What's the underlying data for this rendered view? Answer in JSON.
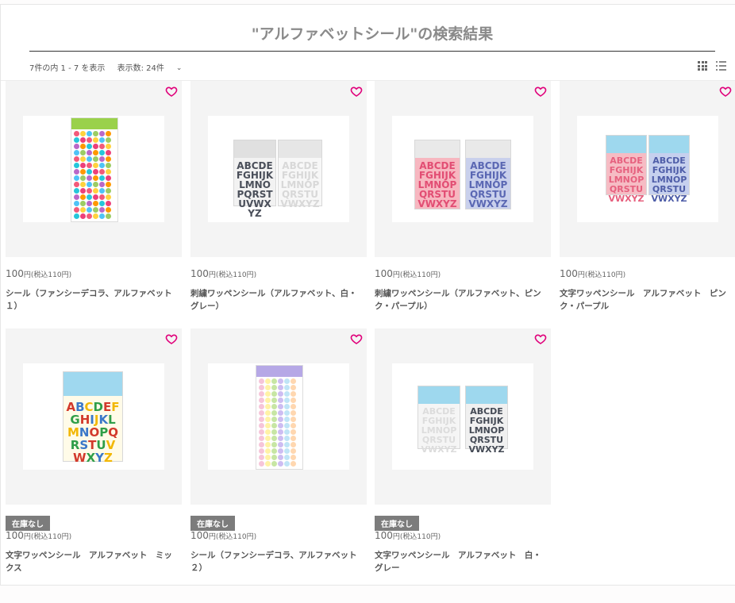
{
  "search": {
    "title": "\"アルファベットシール\"の検索結果",
    "result_count": "7件の内 1 - 7 を表示",
    "per_page": "表示数: 24件"
  },
  "out_of_stock_label": "在庫なし",
  "colors": {
    "heart": "#e0007a",
    "badge": "#7c7c7c"
  },
  "products": [
    {
      "price": "100",
      "unit": "円(税込110円)",
      "name": "シール（ファンシーデコラ、アルファベット１）",
      "out_of_stock": false
    },
    {
      "price": "100",
      "unit": "円(税込110円)",
      "name": "刺繍ワッペンシール（アルファベット、白・グレー）",
      "out_of_stock": false
    },
    {
      "price": "100",
      "unit": "円(税込110円)",
      "name": "刺繍ワッペンシール（アルファベット、ピンク・パープル）",
      "out_of_stock": false
    },
    {
      "price": "100",
      "unit": "円(税込110円)",
      "name": "文字ワッペンシール　アルファベット　ピンク・パープル",
      "out_of_stock": false
    },
    {
      "price": "100",
      "unit": "円(税込110円)",
      "name": "文字ワッペンシール　アルファベット　ミックス",
      "out_of_stock": true
    },
    {
      "price": "100",
      "unit": "円(税込110円)",
      "name": "シール（ファンシーデコラ、アルファベット２）",
      "out_of_stock": true
    },
    {
      "price": "100",
      "unit": "円(税込110円)",
      "name": "文字ワッペンシール　アルファベット　白・グレー",
      "out_of_stock": true
    }
  ]
}
